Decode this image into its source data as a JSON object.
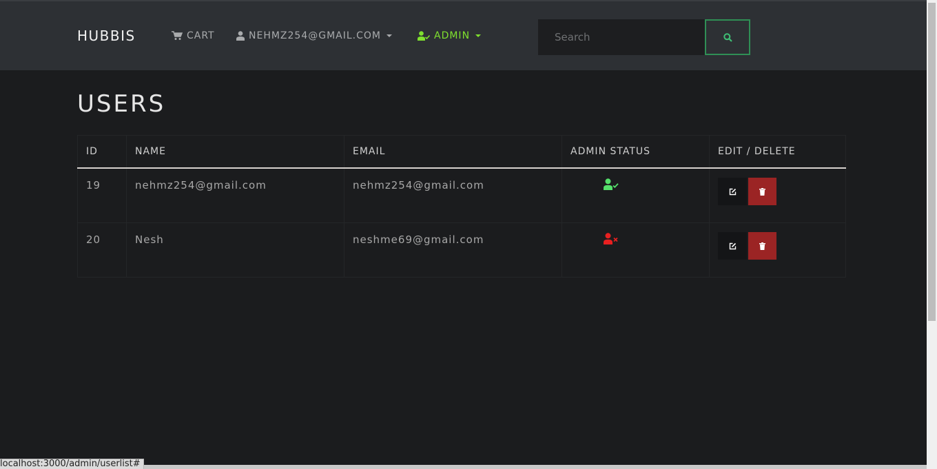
{
  "navbar": {
    "brand": "HUBBIS",
    "cart_label": "CART",
    "user_label": "NEHMZ254@GMAIL.COM",
    "admin_label": "ADMIN",
    "search_placeholder": "Search"
  },
  "page": {
    "title": "USERS"
  },
  "table": {
    "headers": [
      "ID",
      "NAME",
      "EMAIL",
      "ADMIN STATUS",
      "EDIT / DELETE"
    ],
    "rows": [
      {
        "id": "19",
        "name": "nehmz254@gmail.com",
        "email": "nehmz254@gmail.com",
        "admin_icon": "user-check-icon",
        "admin_color": "#55e06b"
      },
      {
        "id": "20",
        "name": "Nesh",
        "email": "neshme69@gmail.com",
        "admin_icon": "user-times-icon",
        "admin_color": "#e82020"
      }
    ]
  },
  "colors": {
    "admin_accent": "#7fe02e",
    "delete_button": "#9b2424",
    "search_border": "#2f8f55"
  },
  "status_bar": {
    "url": "localhost:3000/admin/userlist#"
  }
}
